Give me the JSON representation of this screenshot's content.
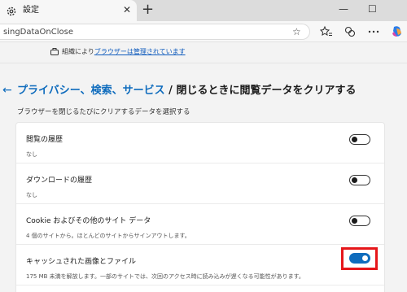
{
  "tab": {
    "title": "設定",
    "close": "✕"
  },
  "new_tab": "+",
  "window_controls": {
    "minimize": "—",
    "maximize": "☐"
  },
  "address_bar": {
    "url": "singDataOnClose",
    "favorite": "☆"
  },
  "toolbar_icons": [
    "split-screen-icon",
    "favorites-icon",
    "extensions-icon",
    "more-icon",
    "copilot-icon"
  ],
  "managed_banner": {
    "prefix": "組織により",
    "link": "ブラウザーは管理されています"
  },
  "header": {
    "back": "←",
    "breadcrumb": "プライバシー、検索、サービス",
    "separator": " / ",
    "title": "閉じるときに閲覧データをクリアする",
    "subtitle": "ブラウザーを閉じるたびにクリアするデータを選択する"
  },
  "items": [
    {
      "title": "閲覧の履歴",
      "desc": "なし",
      "enabled": false
    },
    {
      "title": "ダウンロードの履歴",
      "desc": "なし",
      "enabled": false
    },
    {
      "title": "Cookie およびその他のサイト データ",
      "desc": "4 個のサイトから。ほとんどのサイトからサインアウトします。",
      "enabled": false
    },
    {
      "title": "キャッシュされた画像とファイル",
      "desc": "175 MB 未満を解放します。一部のサイトでは、次回のアクセス時に読み込みが遅くなる可能性があります。",
      "enabled": true
    }
  ],
  "colors": {
    "accent": "#0f6cbd",
    "highlight": "#e6161a"
  }
}
